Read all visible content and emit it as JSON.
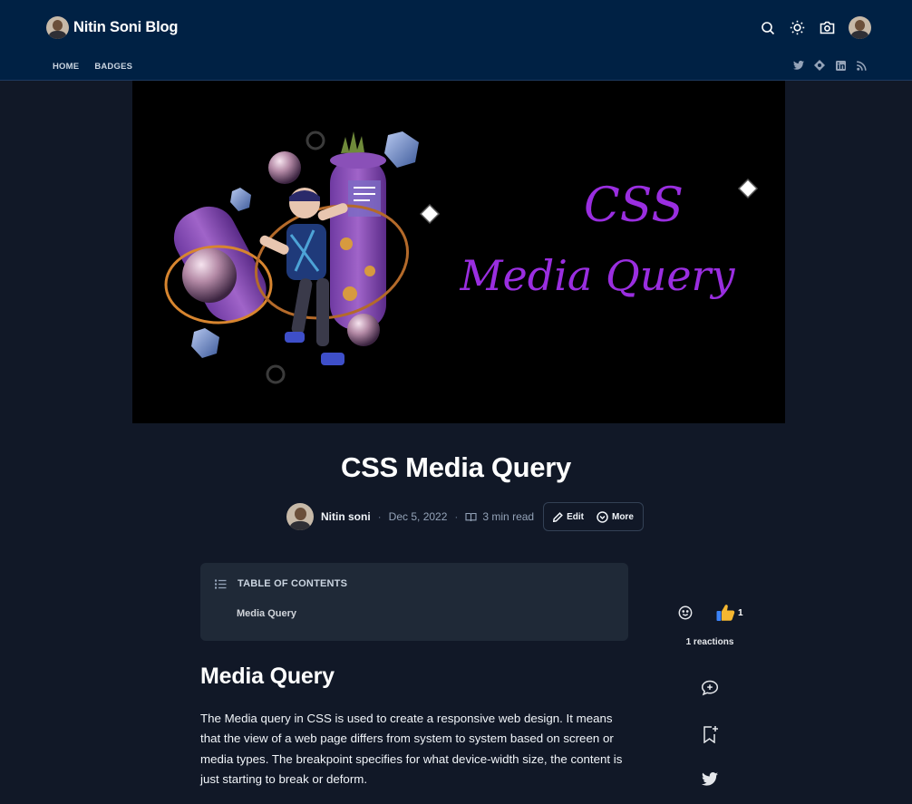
{
  "header": {
    "blog_name": "Nitin Soni Blog",
    "nav": [
      "HOME",
      "BADGES"
    ],
    "icons": [
      "search-icon",
      "sun-icon",
      "camera-folder-icon",
      "profile-avatar"
    ],
    "social_icons": [
      "twitter-icon",
      "hashnode-icon",
      "linkedin-icon",
      "rss-icon"
    ],
    "background": "#002144"
  },
  "cover": {
    "line1": "CSS",
    "line2": "Media Query",
    "accent": "#9a2ee0"
  },
  "post": {
    "title": "CSS Media Query",
    "author": "Nitin soni",
    "date": "Dec 5, 2022",
    "read_time": "3 min read",
    "edit_label": "Edit",
    "more_label": "More"
  },
  "toc": {
    "title": "TABLE OF CONTENTS",
    "items": [
      "Media Query"
    ]
  },
  "content": {
    "heading": "Media Query",
    "paragraph": "The Media query in CSS is used to create a responsive web design. It means that the view of a web page differs from system to system based on screen or media types. The breakpoint specifies for what device-width size, the content is just starting to break or deform."
  },
  "sidebar": {
    "like_count": "1",
    "reactions_label": "1 reactions"
  }
}
